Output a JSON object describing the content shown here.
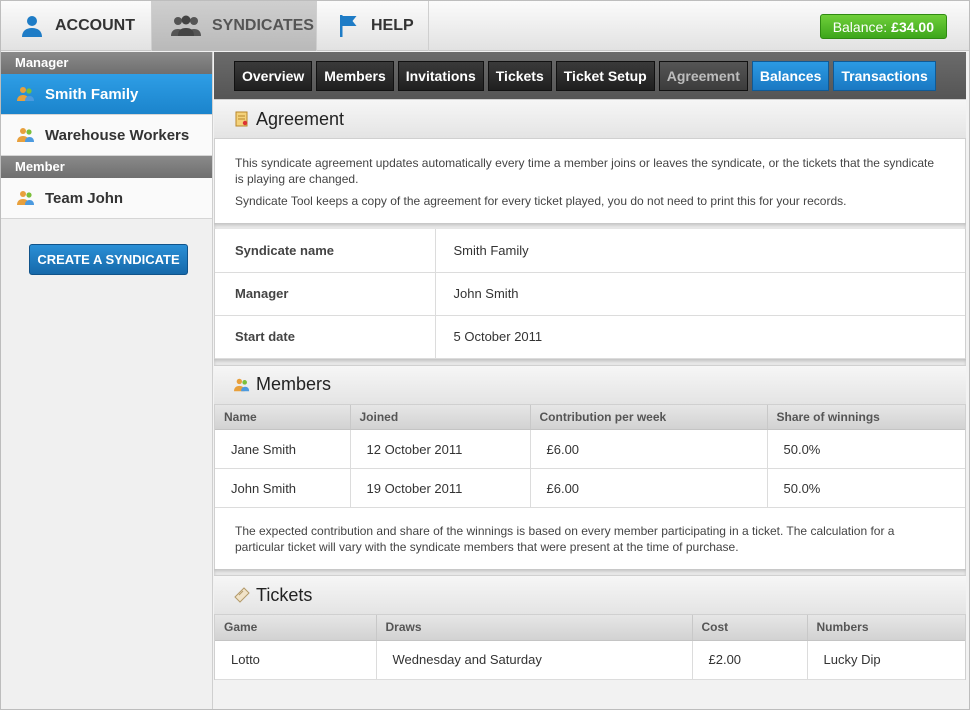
{
  "topnav": {
    "tabs": [
      {
        "label": "ACCOUNT",
        "icon": "user-icon"
      },
      {
        "label": "SYNDICATES",
        "icon": "group-icon"
      },
      {
        "label": "HELP",
        "icon": "flag-icon"
      }
    ],
    "balance_label": "Balance:",
    "balance_value": "£34.00"
  },
  "sidebar": {
    "manager_heading": "Manager",
    "manager_items": [
      "Smith Family",
      "Warehouse Workers"
    ],
    "member_heading": "Member",
    "member_items": [
      "Team John"
    ],
    "create_button": "CREATE A SYNDICATE"
  },
  "subtabs": [
    "Overview",
    "Members",
    "Invitations",
    "Tickets",
    "Ticket Setup",
    "Agreement",
    "Balances",
    "Transactions"
  ],
  "agreement": {
    "title": "Agreement",
    "intro1": "This syndicate agreement updates automatically every time a member joins or leaves the syndicate, or the tickets that the syndicate is playing are changed.",
    "intro2": "Syndicate Tool keeps a copy of the agreement for every ticket played, you do not need to print this for your records.",
    "details": [
      {
        "label": "Syndicate name",
        "value": "Smith Family"
      },
      {
        "label": "Manager",
        "value": "John Smith"
      },
      {
        "label": "Start date",
        "value": "5 October 2011"
      }
    ]
  },
  "members": {
    "title": "Members",
    "columns": [
      "Name",
      "Joined",
      "Contribution per week",
      "Share of winnings"
    ],
    "rows": [
      [
        "Jane Smith",
        "12 October 2011",
        "£6.00",
        "50.0%"
      ],
      [
        "John Smith",
        "19 October 2011",
        "£6.00",
        "50.0%"
      ]
    ],
    "note": "The expected contribution and share of the winnings is based on every member participating in a ticket. The calculation for a particular ticket will vary with the syndicate members that were present at the time of purchase."
  },
  "tickets": {
    "title": "Tickets",
    "columns": [
      "Game",
      "Draws",
      "Cost",
      "Numbers"
    ],
    "rows": [
      [
        "Lotto",
        "Wednesday and Saturday",
        "£2.00",
        "Lucky Dip"
      ]
    ]
  },
  "colors": {
    "accent_blue": "#1b84cc",
    "balance_green": "#3da61b"
  }
}
